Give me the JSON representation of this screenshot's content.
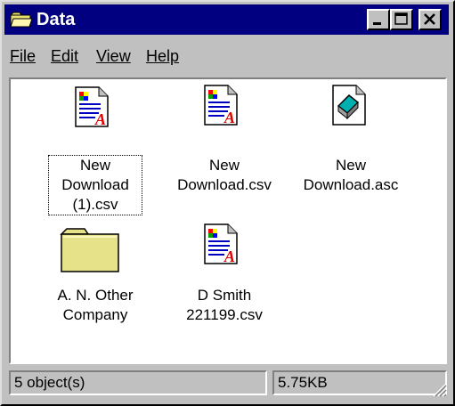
{
  "window": {
    "title": "Data"
  },
  "titlebar_buttons": {
    "minimize": "minimize",
    "maximize": "maximize",
    "close": "close"
  },
  "menu": [
    {
      "label": "File"
    },
    {
      "label": "Edit"
    },
    {
      "label": "View"
    },
    {
      "label": "Help"
    }
  ],
  "items": [
    {
      "label": "New\nDownload\n(1).csv",
      "icon": "csv-file-icon",
      "selected": true
    },
    {
      "label": "New\nDownload.csv",
      "icon": "csv-file-icon",
      "selected": false
    },
    {
      "label": "New\nDownload.asc",
      "icon": "asc-file-icon",
      "selected": false
    },
    {
      "label": "A. N. Other\nCompany",
      "icon": "folder-icon",
      "selected": false
    },
    {
      "label": "D Smith\n221199.csv",
      "icon": "csv-file-icon",
      "selected": false
    }
  ],
  "status": {
    "objects": "5 object(s)",
    "size": "5.75KB"
  },
  "colors": {
    "titlebar": "#000080",
    "face": "#c0c0c0",
    "folder": "#e6e28a"
  }
}
